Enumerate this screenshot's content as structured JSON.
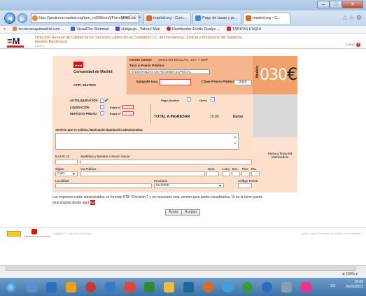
{
  "browser": {
    "address": "http://gestiona.madrid.org/tpm_m030/run/j/FormM030.icc",
    "address_controls": "ρ ▾ ☐ C ✕",
    "tabs": [
      {
        "label": "madrid.org - Com...",
        "color": "#e06a1a"
      },
      {
        "label": "Pago de tasas y pr...",
        "color": "#3a8ad6"
      },
      {
        "label": "madrid.org - C...",
        "color": "#e06a1a"
      }
    ],
    "favorites": [
      {
        "label": "tecnicoesquimadrid.com ...",
        "color": "#e08a3a"
      },
      {
        "label": "VisualTec Webmail",
        "color": "#3a6ac6"
      },
      {
        "label": "clubjauja - Yahoo! Mail",
        "color": "#6a3ac6"
      },
      {
        "label": "Distribuidor Evolis Dualys ...",
        "color": "#d22"
      },
      {
        "label": "TARIFAS ESQUI",
        "color": "#d22"
      }
    ]
  },
  "site": {
    "logo_text": "≡M",
    "title_line1": "Dirección General de Calidad de los Servicios y Atención al Ciudadano | C. de Presidencia, Justicia y Portavocía del Gobierno",
    "title_line2": "Gestión Electrónica",
    "breadcrumb": "Inicio >",
    "close_label": "Cerrar"
  },
  "form": {
    "comunidad": "Comunidad de Madrid",
    "cpr": "CPR: 9047023",
    "centro_gestor_label": "Centro Gestor",
    "centro_gestor_value": "29022724 EDUCAC. JUV. Y DEP.",
    "tasa_label": "Tasa o Precio Público",
    "tasa_value": "ENSEÑANZAS DE RÉGIMEN ESPECIAL",
    "epigrafe_label": "Epígrafe tasa",
    "clave_label": "Clave Precio Público",
    "clave_value": "2020",
    "modelo_vertical": "Modelo",
    "modelo_number": "030",
    "modelo_currency": "€",
    "autoliquidacion": "AUTOLIQUIDACIÓN",
    "liquidacion": "LIQUIDACIÓN",
    "deposito": "DEPÓSITO PREVIO",
    "expte1": "Expte nº",
    "expte2": "Expte nº",
    "pago_efectivo": "Pago efectivo",
    "otros": "Otros",
    "total_label": "TOTAL A INGRESAR",
    "total_value": "19,00",
    "total_currency": "Euros",
    "servicio_label": "Servicio que se solicita / Motivación liquidación administrativa",
    "nif_label": "N.I.F./C.I.F.",
    "apellidos_label": "Apellidos y Nombre o Razón Social",
    "fecha_label": "Fecha y firma del interesado/a",
    "siglas_label": "Siglas",
    "siglas_value": "Calle",
    "via_label": "Vía Pública",
    "num_label": "Núm.",
    "letra_label": "Letra",
    "esc_label": "Esc.",
    "piso_label": "Piso",
    "pta_label": "Pta.",
    "localidad_label": "Localidad",
    "provincia_label": "Provincia",
    "provincia_value": "MADRID",
    "cp_label": "Código Postal"
  },
  "note": {
    "line1": "Los impresos están almacenados en formato PDF ©Versión 7 y es necesario esta versión para poder visualizarlos. Si no la tiene puede",
    "line2": "descargarla desde aquí"
  },
  "buttons": {
    "ayuda": "Ayuda",
    "aceptar": "Aceptar"
  },
  "footer": {
    "logo2_text": "MADRID CALIDAD DIGITAL",
    "copyright": "Copyright © Comunidad de Madrid",
    "links": "Aviso Legal | Privacidad | Contacto | Accesibilidad"
  },
  "status": {
    "zoom": "⊕ 100%  ▾"
  },
  "tray": {
    "time": "18:08",
    "date": "06/02/2013",
    "lang": "ES"
  }
}
